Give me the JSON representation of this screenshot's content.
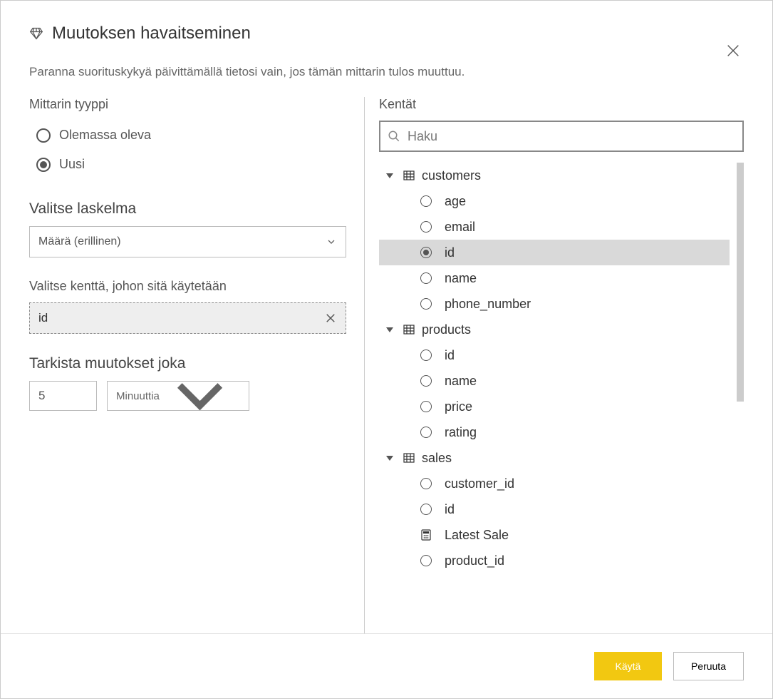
{
  "header": {
    "title": "Muutoksen havaitseminen"
  },
  "description": "Paranna suorituskykyä päivittämällä tietosi vain, jos tämän mittarin tulos muuttuu.",
  "left": {
    "measure_type_label": "Mittarin tyyppi",
    "radio_existing": "Olemassa oleva",
    "radio_new": "Uusi",
    "select_calc_label": "Valitse laskelma",
    "select_calc_value": "Määrä (erillinen)",
    "select_field_label": "Valitse kenttä, johon sitä käytetään",
    "selected_field": "id",
    "check_changes_label": "Tarkista muutokset joka",
    "interval_value": "5",
    "interval_unit": "Minuuttia"
  },
  "right": {
    "fields_label": "Kentät",
    "search_placeholder": "Haku",
    "tables": [
      {
        "name": "customers",
        "fields": [
          {
            "name": "age",
            "type": "field",
            "selected": false
          },
          {
            "name": "email",
            "type": "field",
            "selected": false
          },
          {
            "name": "id",
            "type": "field",
            "selected": true
          },
          {
            "name": "name",
            "type": "field",
            "selected": false
          },
          {
            "name": "phone_number",
            "type": "field",
            "selected": false
          }
        ]
      },
      {
        "name": "products",
        "fields": [
          {
            "name": "id",
            "type": "field",
            "selected": false
          },
          {
            "name": "name",
            "type": "field",
            "selected": false
          },
          {
            "name": "price",
            "type": "field",
            "selected": false
          },
          {
            "name": "rating",
            "type": "field",
            "selected": false
          }
        ]
      },
      {
        "name": "sales",
        "fields": [
          {
            "name": "customer_id",
            "type": "field",
            "selected": false
          },
          {
            "name": "id",
            "type": "field",
            "selected": false
          },
          {
            "name": "Latest Sale",
            "type": "measure",
            "selected": false
          },
          {
            "name": "product_id",
            "type": "field",
            "selected": false
          }
        ]
      }
    ]
  },
  "footer": {
    "apply": "Käytä",
    "cancel": "Peruuta"
  }
}
